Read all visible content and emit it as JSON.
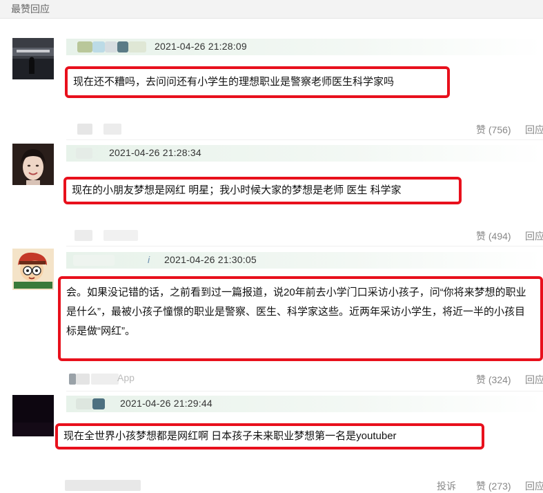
{
  "header": {
    "title": "最赞回应"
  },
  "comments": [
    {
      "timestamp": "2021-04-26 21:28:09",
      "text": "现在还不糟吗，去问问还有小学生的理想职业是警察老师医生科学家吗",
      "like_label": "赞 (756)",
      "reply_label": "回应"
    },
    {
      "timestamp": "2021-04-26 21:28:34",
      "text": "现在的小朋友梦想是网红 明星；我小时候大家的梦想是老师 医生 科学家",
      "like_label": "赞 (494)",
      "reply_label": "回应"
    },
    {
      "timestamp": "2021-04-26 21:30:05",
      "name_fragment": "i",
      "text": "会。如果没记错的话，之前看到过一篇报道，说20年前去小学门口采访小孩子，问“你将来梦想的职业是什么”，最被小孩子憧憬的职业是警察、医生、科学家这些。近两年采访小学生，将近一半的小孩目标是做“网红”。",
      "app_label": "App",
      "like_label": "赞 (324)",
      "reply_label": "回应"
    },
    {
      "timestamp": "2021-04-26 21:29:44",
      "text": "现在全世界小孩梦想都是网红啊 日本孩子未来职业梦想第一名是youtuber",
      "report_label": "投诉",
      "like_label": "赞 (273)",
      "reply_label": "回应"
    }
  ],
  "colors": {
    "highlight_border": "#e8101c",
    "meta_bar": "#e7f2ea",
    "muted_text": "#888888"
  }
}
